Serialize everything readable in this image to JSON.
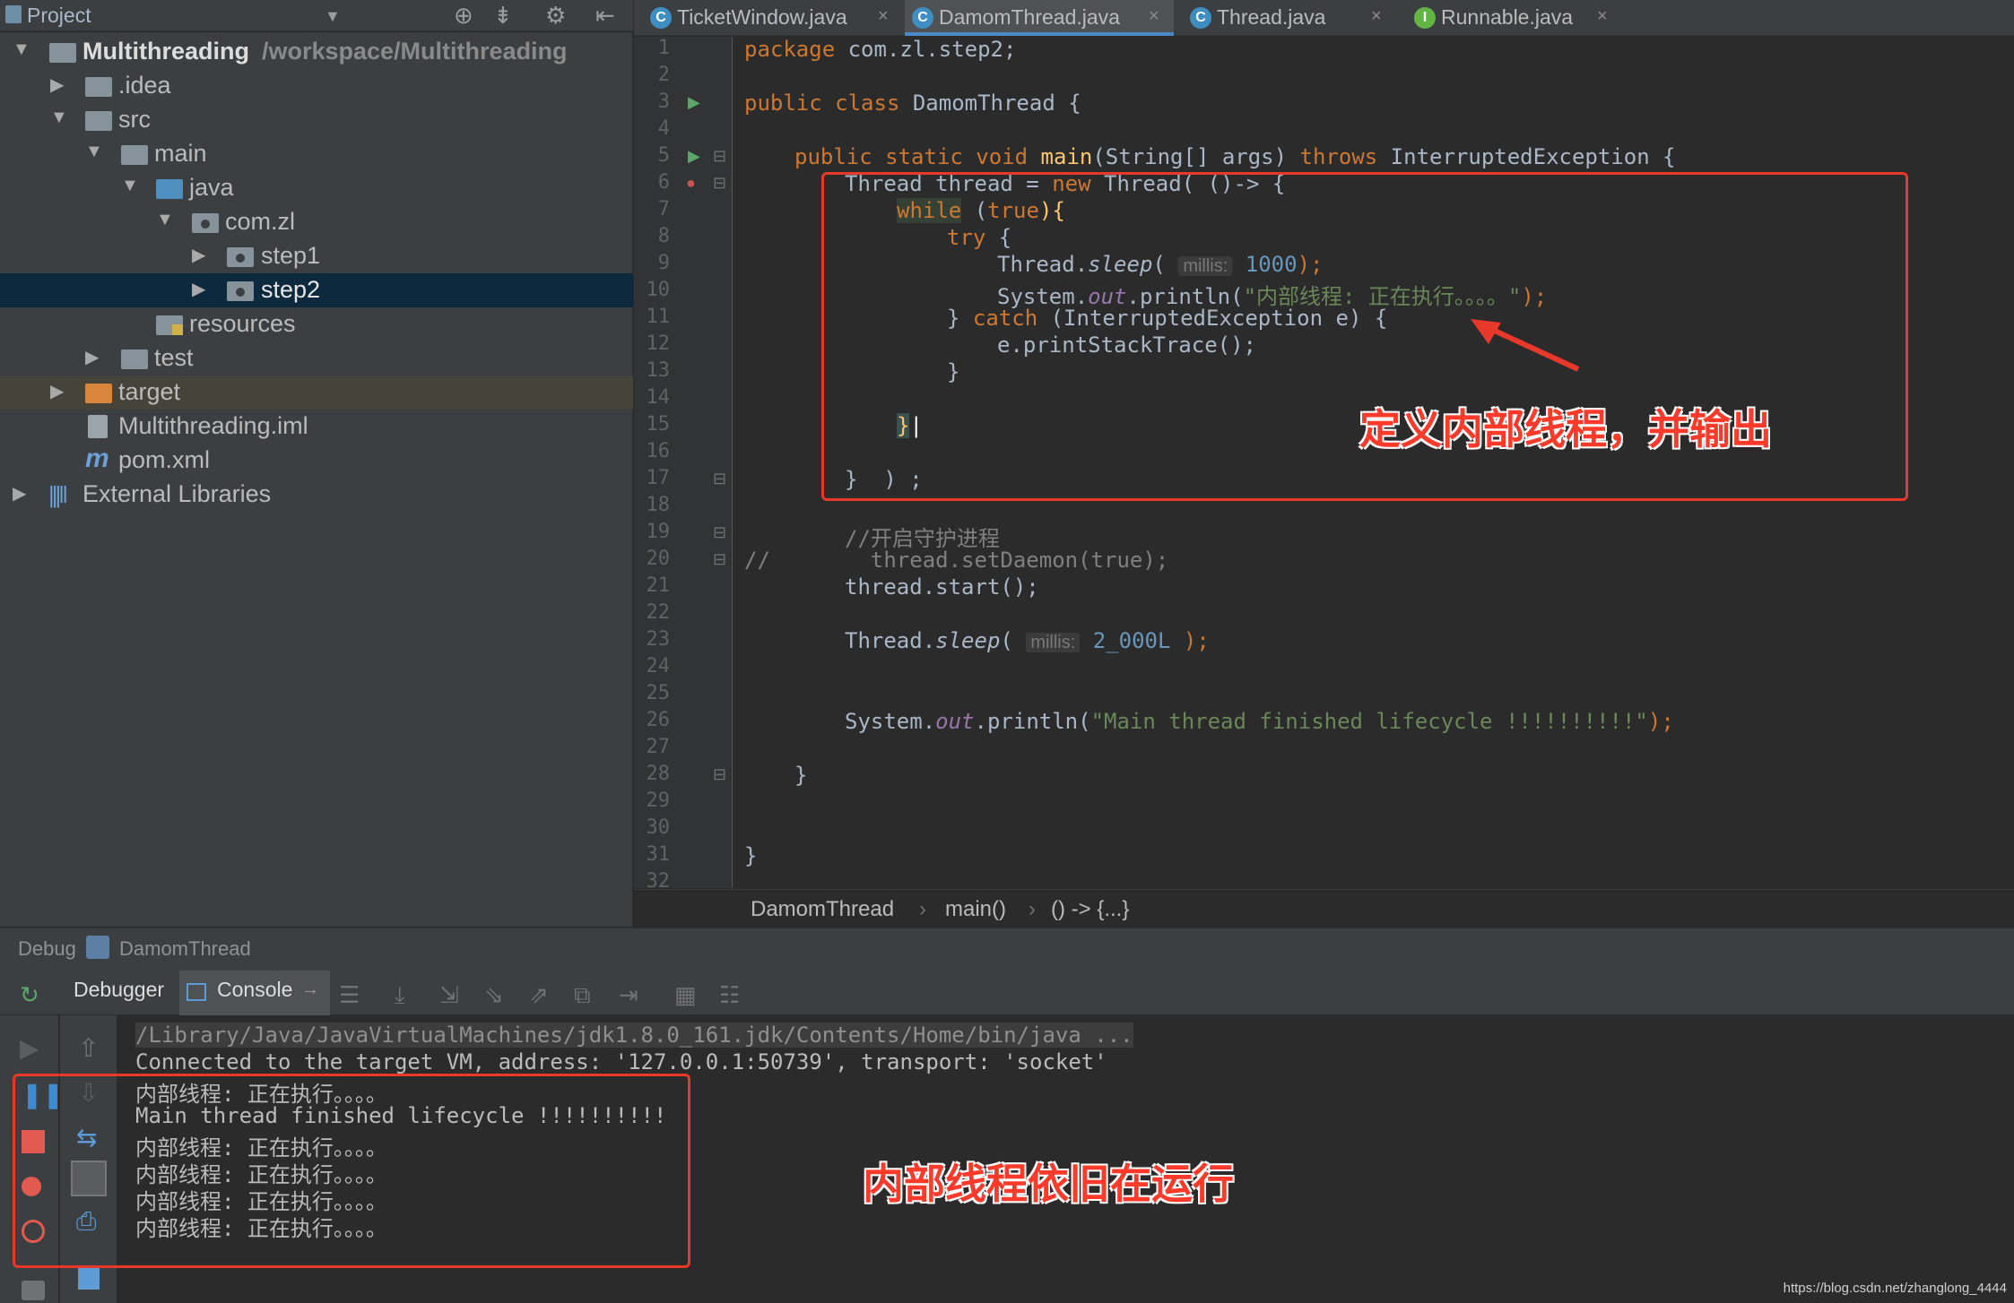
{
  "project_panel": {
    "title": "Project",
    "tree": [
      {
        "name": "Multithreading",
        "path": "/workspace/Multithreading"
      },
      {
        "name": ".idea"
      },
      {
        "name": "src"
      },
      {
        "name": "main"
      },
      {
        "name": "java"
      },
      {
        "name": "com.zl"
      },
      {
        "name": "step1"
      },
      {
        "name": "step2"
      },
      {
        "name": "resources"
      },
      {
        "name": "test"
      },
      {
        "name": "target"
      },
      {
        "name": "Multithreading.iml"
      },
      {
        "name": "pom.xml"
      },
      {
        "name": "External Libraries"
      }
    ]
  },
  "tabs": [
    {
      "label": "TicketWindow.java",
      "icon": "C"
    },
    {
      "label": "DamomThread.java",
      "icon": "C"
    },
    {
      "label": "Thread.java",
      "icon": "C"
    },
    {
      "label": "Runnable.java",
      "icon": "I"
    }
  ],
  "editor": {
    "line_numbers": [
      "1",
      "2",
      "3",
      "4",
      "5",
      "6",
      "7",
      "8",
      "9",
      "10",
      "11",
      "12",
      "13",
      "14",
      "15",
      "16",
      "17",
      "18",
      "19",
      "20",
      "21",
      "22",
      "23",
      "24",
      "25",
      "26",
      "27",
      "28",
      "29",
      "30",
      "31",
      "32"
    ],
    "code": {
      "l1_kw": "package",
      "l1_rest": " com.zl.step2;",
      "l3_kw": "public class",
      "l3_cls": " DamomThread",
      "l3_rest": " {",
      "l5_kw": "public static void",
      "l5_fn": " main",
      "l5_args": "(String[] args) ",
      "l5_throws": "throws",
      "l5_rest": " InterruptedException {",
      "l6_a": "Thread thread = ",
      "l6_new": "new",
      "l6_b": " Thread( ()-> {",
      "l7_kw": "while",
      "l7_rest": " (",
      "l7_true": "true",
      "l7_end": "){",
      "l8_kw": "try",
      "l8_rest": " {",
      "l9_a": "Thread.",
      "l9_fn": "sleep",
      "l9_b": "( ",
      "l9_hint": "millis:",
      "l9_num": " 1000",
      "l9_end": ");",
      "l10_a": "System.",
      "l10_out": "out",
      "l10_b": ".println(",
      "l10_str": "\"内部线程: 正在执行。。。。\"",
      "l10_end": ");",
      "l11_a": "} ",
      "l11_kw": "catch",
      "l11_b": " (InterruptedException e) {",
      "l12": "e.printStackTrace();",
      "l13": "}",
      "l15": "}",
      "l17": "}  ) ;",
      "l19": "//开启守护进程",
      "l20_a": "//",
      "l20_b": "thread.setDaemon(true);",
      "l21": "thread.start();",
      "l23_a": "Thread.",
      "l23_fn": "sleep",
      "l23_b": "( ",
      "l23_hint": "millis:",
      "l23_num": " 2_000L",
      "l23_end": " );",
      "l26_a": "System.",
      "l26_out": "out",
      "l26_b": ".println(",
      "l26_str": "\"Main thread finished lifecycle !!!!!!!!!!\"",
      "l26_end": ");",
      "l28": "}",
      "l31": "}"
    }
  },
  "breadcrumb": [
    "DamomThread",
    "main()",
    "() -> {...}"
  ],
  "debug": {
    "title": "Debug",
    "config": "DamomThread",
    "tabs": {
      "debugger": "Debugger",
      "console": "Console"
    },
    "console_lines": [
      "/Library/Java/JavaVirtualMachines/jdk1.8.0_161.jdk/Contents/Home/bin/java ...",
      "Connected to the target VM, address: '127.0.0.1:50739', transport: 'socket'",
      "内部线程: 正在执行。。。。",
      "Main thread finished lifecycle !!!!!!!!!!",
      "内部线程: 正在执行。。。。",
      "内部线程: 正在执行。。。。",
      "内部线程: 正在执行。。。。",
      "内部线程: 正在执行。。。。"
    ]
  },
  "annotations": {
    "editor_note": "定义内部线程，并输出",
    "console_note": "内部线程依旧在运行"
  },
  "watermark": "https://blog.csdn.net/zhanglong_4444",
  "colors": {
    "annotation_red": "#e8382a",
    "active_tab_underline": "#4a88c7",
    "keyword": "#cc7832",
    "string": "#6a8759"
  }
}
